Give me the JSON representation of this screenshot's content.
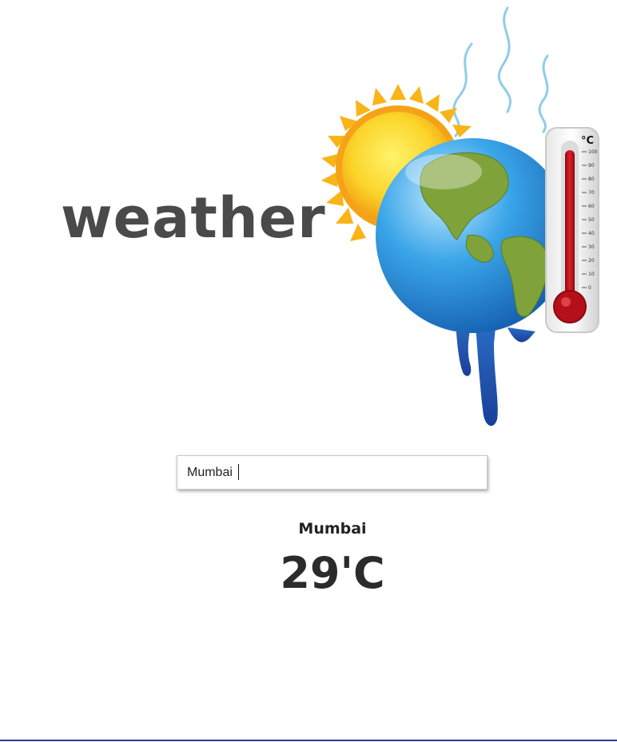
{
  "header": {
    "wordmark": "weather",
    "illustration_icon": "sun-globe-thermometer-illustration",
    "thermometer_unit": "°C",
    "thermometer_scale": [
      "100",
      "90",
      "80",
      "70",
      "60",
      "50",
      "40",
      "30",
      "20",
      "10",
      "0"
    ]
  },
  "search": {
    "value": "Mumbai",
    "placeholder": ""
  },
  "result": {
    "city": "Mumbai",
    "temperature": "29'C"
  },
  "colors": {
    "wordmark": "#4a4a4a",
    "sun": "#f7b31a",
    "globe_water": "#2f9be0",
    "globe_land": "#7a9a2c",
    "thermometer_mercury": "#c0101a",
    "bottom_rule": "#2a3a8c"
  }
}
